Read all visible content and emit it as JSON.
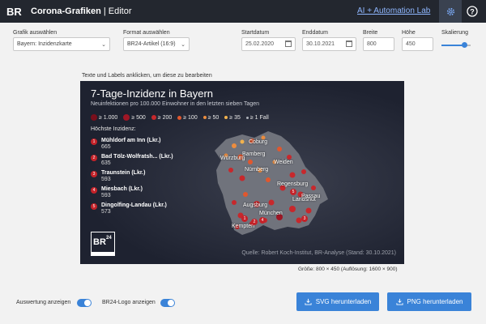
{
  "header": {
    "app_name": "Corona-Grafiken",
    "separator": "|",
    "section": "Editor",
    "lab_link": "AI + Automation Lab"
  },
  "controls": {
    "grafik_label": "Grafik auswählen",
    "grafik_value": "Bayern: Inzidenzkarte",
    "format_label": "Format auswählen",
    "format_value": "BR24-Artikel (16:9)",
    "startdatum_label": "Startdatum",
    "startdatum_value": "25.02.2020",
    "enddatum_label": "Enddatum",
    "enddatum_value": "30.10.2021",
    "breite_label": "Breite",
    "breite_value": "800",
    "hoehe_label": "Höhe",
    "hoehe_value": "450",
    "skalierung_label": "Skalierung",
    "skalierung_level": 0.78
  },
  "hint": "Texte und Labels anklicken, um diese zu bearbeiten",
  "graphic": {
    "title": "7-Tage-Inzidenz in Bayern",
    "subtitle": "Neuinfektionen pro 100.000 Einwohner in den letzten sieben Tagen",
    "legend": [
      {
        "label": "≥ 1.000",
        "color": "#7a0f1c"
      },
      {
        "label": "≥ 500",
        "color": "#9e1625"
      },
      {
        "label": "≥ 200",
        "color": "#c7282c"
      },
      {
        "label": "≥ 100",
        "color": "#e0572e"
      },
      {
        "label": "≥ 50",
        "color": "#ec8d3f"
      },
      {
        "label": "≥ 35",
        "color": "#f1b24e"
      },
      {
        "label": "≥ 1 Fall",
        "color": "#aeb2ba"
      }
    ],
    "top_heading": "Höchste Inzidenz:",
    "top_list": [
      {
        "rank": "1",
        "name": "Mühldorf am Inn (Lkr.)",
        "value": "665"
      },
      {
        "rank": "2",
        "name": "Bad Tölz-Wolfratsh... (Lkr.)",
        "value": "635"
      },
      {
        "rank": "3",
        "name": "Traunstein (Lkr.)",
        "value": "593"
      },
      {
        "rank": "4",
        "name": "Miesbach (Lkr.)",
        "value": "593"
      },
      {
        "rank": "5",
        "name": "Dingolfing-Landau (Lkr.)",
        "value": "573"
      }
    ],
    "cities": {
      "coburg": "Coburg",
      "bamberg": "Bamberg",
      "wuerzburg": "Würzburg",
      "weiden": "Weiden",
      "nuernberg": "Nürnberg",
      "regensburg": "Regensburg",
      "landshut": "Landshut",
      "passau": "Passau",
      "augsburg": "Augsburg",
      "muenchen": "München",
      "kempten": "Kempten"
    },
    "map_numbers": {
      "n1": "1",
      "n2": "2",
      "n3": "3",
      "n4": "4",
      "n5": "5"
    },
    "logo_text": "BR24",
    "source": "Quelle: Robert Koch-Institut, BR-Analyse (Stand: 30.10.2021)"
  },
  "size_note": "Größe: 800 × 450 (Auflösung: 1600 × 900)",
  "bottom": {
    "auswertung_label": "Auswertung anzeigen",
    "logo_toggle_label": "BR24-Logo anzeigen",
    "svg_button": "SVG herunterladen",
    "png_button": "PNG herunterladen"
  },
  "colors": {
    "accent": "#3a83d8",
    "header_bg": "#23272f",
    "graphic_bg": "#1e2230",
    "badge_red": "#c42229"
  },
  "icons": [
    "br-logo-icon",
    "gear-icon",
    "help-icon",
    "calendar-icon",
    "download-icon"
  ]
}
